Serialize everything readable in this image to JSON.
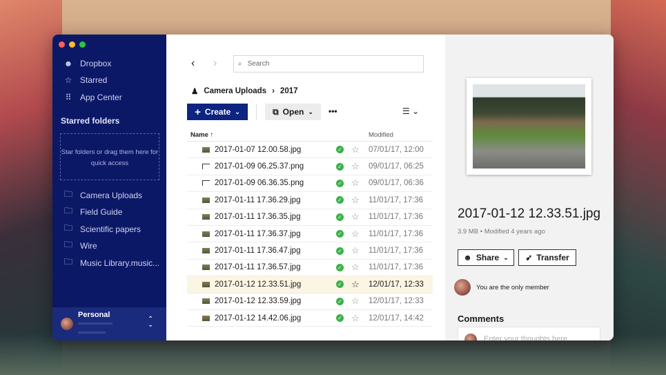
{
  "window_controls": {
    "close": "#ff5f57",
    "minimize": "#febc2e",
    "zoom": "#28c840"
  },
  "sidebar": {
    "nav": [
      {
        "label": "Dropbox",
        "icon": "person-icon"
      },
      {
        "label": "Starred",
        "icon": "star-icon"
      },
      {
        "label": "App Center",
        "icon": "grid-icon"
      }
    ],
    "starred_title": "Starred folders",
    "dropzone_text": "Star folders or drag them here for quick access",
    "folders": [
      {
        "label": "Camera Uploads"
      },
      {
        "label": "Field Guide"
      },
      {
        "label": "Scientific papers"
      },
      {
        "label": "Wire"
      },
      {
        "label": "Music Library.music..."
      }
    ],
    "account": {
      "name": "Personal"
    }
  },
  "toolbar": {
    "search_placeholder": "Search",
    "create_label": "Create",
    "open_label": "Open",
    "more": "•••"
  },
  "breadcrumb": [
    "Camera Uploads",
    "2017"
  ],
  "table": {
    "col_name": "Name",
    "col_modified": "Modified",
    "sort": "↑",
    "rows": [
      {
        "name": "2017-01-07 12.00.58.jpg",
        "type": "jpg",
        "modified": "07/01/17, 12:00"
      },
      {
        "name": "2017-01-09 06.25.37.png",
        "type": "png",
        "modified": "09/01/17, 06:25"
      },
      {
        "name": "2017-01-09 06.36.35.png",
        "type": "png",
        "modified": "09/01/17, 06:36"
      },
      {
        "name": "2017-01-11 17.36.29.jpg",
        "type": "jpg",
        "modified": "11/01/17, 17:36"
      },
      {
        "name": "2017-01-11 17.36.35.jpg",
        "type": "jpg",
        "modified": "11/01/17, 17:36"
      },
      {
        "name": "2017-01-11 17.36.37.jpg",
        "type": "jpg",
        "modified": "11/01/17, 17:36"
      },
      {
        "name": "2017-01-11 17.36.47.jpg",
        "type": "jpg",
        "modified": "11/01/17, 17:36"
      },
      {
        "name": "2017-01-11 17.36.57.jpg",
        "type": "jpg",
        "modified": "11/01/17, 17:36"
      },
      {
        "name": "2017-01-12 12.33.51.jpg",
        "type": "jpg",
        "modified": "12/01/17, 12:33",
        "selected": true
      },
      {
        "name": "2017-01-12 12.33.59.jpg",
        "type": "jpg",
        "modified": "12/01/17, 12:33"
      },
      {
        "name": "2017-01-12 14.42.06.jpg",
        "type": "jpg",
        "modified": "12/01/17, 14:42"
      }
    ]
  },
  "preview": {
    "filename": "2017-01-12 12.33.51.jpg",
    "meta": "3.9 MB • Modified 4 years ago",
    "share_label": "Share",
    "transfer_label": "Transfer",
    "members_text": "You are the only member",
    "comments_title": "Comments",
    "comment_placeholder": "Enter your thoughts here"
  },
  "colors": {
    "sidebar": "#0b1866",
    "accent": "#0d2481",
    "sync_ok": "#3cb14a",
    "selected_row": "#fbf5e3"
  }
}
